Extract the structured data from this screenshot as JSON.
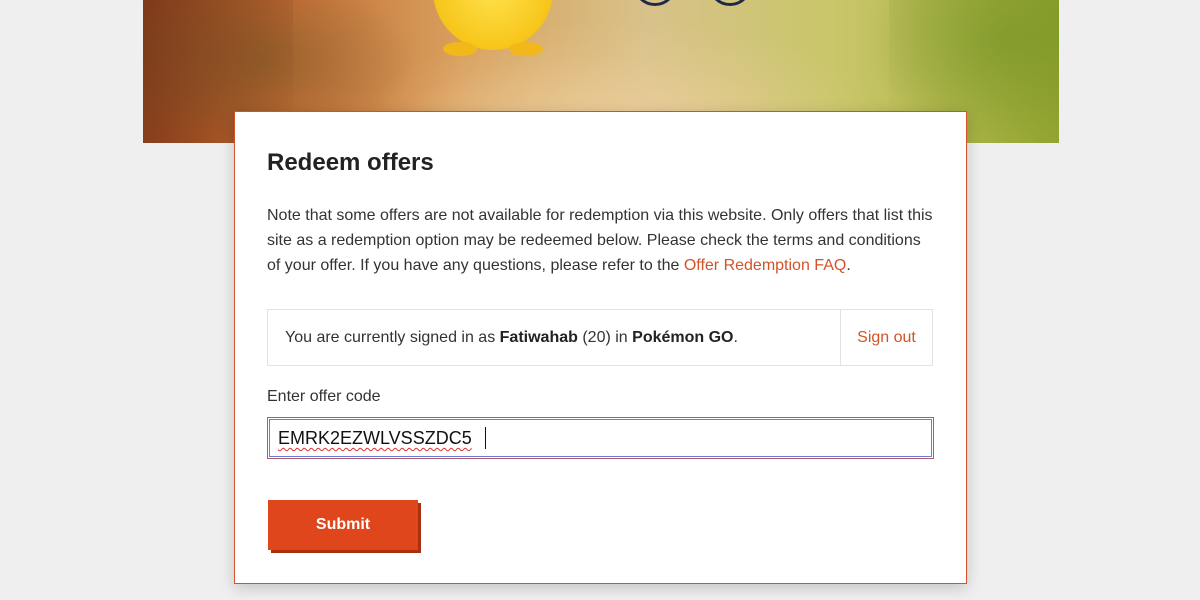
{
  "card": {
    "title": "Redeem offers",
    "note_text": "Note that some offers are not available for redemption via this website. Only offers that list this site as a redemption option may be redeemed below. Please check the terms and conditions of your offer. If you have any questions, please refer to the ",
    "faq_link": "Offer Redemption FAQ",
    "note_end": "."
  },
  "signed_in": {
    "prefix": "You are currently signed in as ",
    "username": "Fatiwahab",
    "level": "(20)",
    "middle": " in ",
    "game": "Pokémon GO",
    "suffix": ".",
    "sign_out_label": "Sign out"
  },
  "offer_code": {
    "label": "Enter offer code",
    "value": "EMRK2EZWLVSSZDC5"
  },
  "submit_label": "Submit",
  "colors": {
    "accent": "#e0461c",
    "link": "#d2532a",
    "text": "#333333",
    "background": "#efefef"
  }
}
